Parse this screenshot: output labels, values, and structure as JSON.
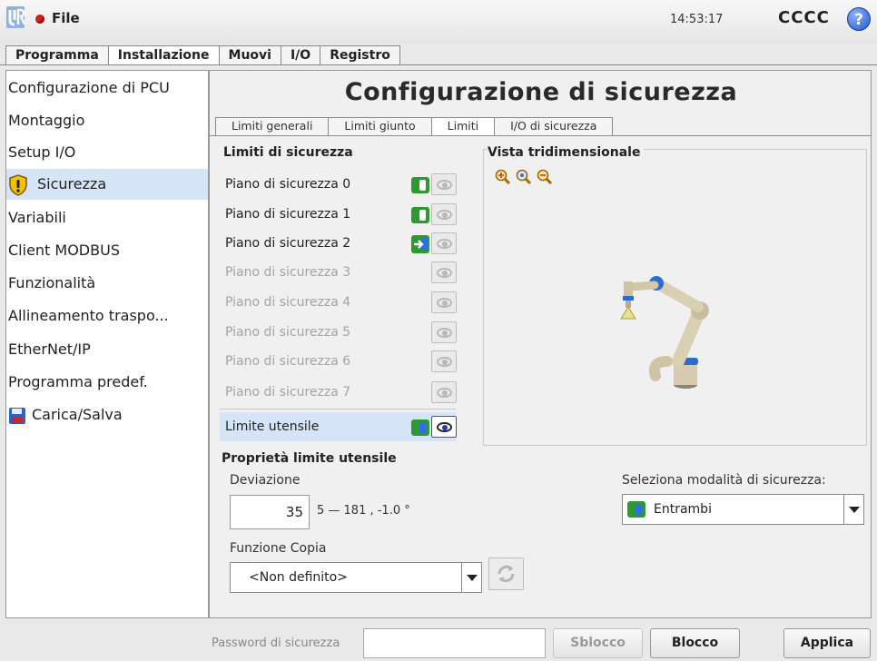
{
  "topbar": {
    "file_label": "File",
    "clock": "14:53:17",
    "robot_name": "CCCC",
    "help_symbol": "?",
    "logo_icon": "ur-logo-icon",
    "status_icon": "red-status-dot"
  },
  "main_tabs": [
    {
      "label": "Programma",
      "active": false
    },
    {
      "label": "Installazione",
      "active": true
    },
    {
      "label": "Muovi",
      "active": false
    },
    {
      "label": "I/O",
      "active": false
    },
    {
      "label": "Registro",
      "active": false
    }
  ],
  "sidebar": {
    "items": [
      {
        "label": "Configurazione di PCU"
      },
      {
        "label": "Montaggio"
      },
      {
        "label": "Setup I/O"
      },
      {
        "label": "Sicurezza",
        "icon": "shield-warning-icon",
        "active": true
      },
      {
        "label": "Variabili"
      },
      {
        "label": "Client MODBUS"
      },
      {
        "label": "Funzionalità"
      },
      {
        "label": "Allineamento traspo..."
      },
      {
        "label": "EtherNet/IP"
      },
      {
        "label": "Programma predef."
      },
      {
        "label": "Carica/Salva",
        "icon": "floppy-disk-icon"
      }
    ]
  },
  "content": {
    "title": "Configurazione di sicurezza",
    "sub_tabs": [
      {
        "label": "Limiti generali",
        "active": false
      },
      {
        "label": "Limiti giunto",
        "active": false
      },
      {
        "label": "Limiti",
        "active": true
      },
      {
        "label": "I/O di sicurezza",
        "active": false
      }
    ],
    "limits_heading": "Limiti di sicurezza",
    "planes": [
      {
        "label": "Piano di sicurezza 0",
        "enabled": true,
        "mode": "normal-reduced"
      },
      {
        "label": "Piano di sicurezza 1",
        "enabled": true,
        "mode": "normal-reduced"
      },
      {
        "label": "Piano di sicurezza 2",
        "enabled": true,
        "mode": "trigger"
      },
      {
        "label": "Piano di sicurezza 3",
        "enabled": false
      },
      {
        "label": "Piano di sicurezza 4",
        "enabled": false
      },
      {
        "label": "Piano di sicurezza 5",
        "enabled": false
      },
      {
        "label": "Piano di sicurezza 6",
        "enabled": false
      },
      {
        "label": "Piano di sicurezza 7",
        "enabled": false
      }
    ],
    "tool_limit": {
      "label": "Limite utensile",
      "selected": true,
      "visible": true
    },
    "view_heading": "Vista tridimensionale",
    "zoom_icons": [
      "zoom-in-icon",
      "zoom-reset-icon",
      "zoom-out-icon"
    ],
    "tool_props_heading": "Proprietà limite utensile",
    "deviation_label": "Deviazione",
    "deviation_value": "35",
    "deviation_range": "5 — 181 , -1.0 °",
    "copy_function_label": "Funzione Copia",
    "copy_function_value": "<Non definito>",
    "mode_select_label": "Seleziona modalità di sicurezza:",
    "mode_select_value": "Entrambi"
  },
  "bottombar": {
    "password_label": "Password di sicurezza",
    "password_value": "",
    "unlock_label": "Sblocco",
    "lock_label": "Blocco",
    "apply_label": "Applica"
  },
  "colors": {
    "selected_row": "#d5e4f6",
    "mode_green": "#2c9a2c",
    "tool_blue": "#2f6fdf",
    "status_red": "#d21d1d"
  }
}
